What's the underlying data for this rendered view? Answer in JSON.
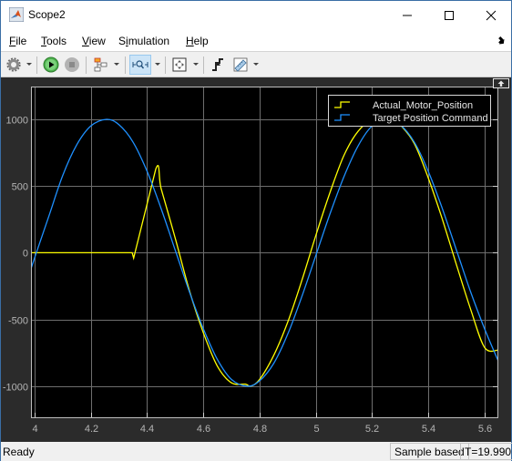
{
  "window": {
    "title": "Scope2",
    "controls": [
      "minimize",
      "maximize",
      "close"
    ]
  },
  "menubar": {
    "items": [
      {
        "label": "File",
        "mnemonic": "F"
      },
      {
        "label": "Tools",
        "mnemonic": "T"
      },
      {
        "label": "View",
        "mnemonic": "V"
      },
      {
        "label": "Simulation",
        "mnemonic": "i"
      },
      {
        "label": "Help",
        "mnemonic": "H"
      }
    ]
  },
  "toolbar": {
    "buttons": [
      {
        "name": "settings",
        "icon": "gear-icon",
        "dropdown": true
      },
      {
        "name": "run",
        "icon": "play-icon",
        "dropdown": false
      },
      {
        "name": "stop",
        "icon": "stop-icon",
        "dropdown": false,
        "disabled": true
      },
      {
        "name": "highlight-block",
        "icon": "block-diagram-icon",
        "dropdown": true
      },
      {
        "name": "zoom",
        "icon": "zoom-x-icon",
        "dropdown": true,
        "active": true
      },
      {
        "name": "scale-axes",
        "icon": "autoscale-icon",
        "dropdown": true
      },
      {
        "name": "triggers",
        "icon": "trigger-icon",
        "dropdown": false
      },
      {
        "name": "measurements",
        "icon": "ruler-icon",
        "dropdown": true
      }
    ]
  },
  "status": {
    "left": "Ready",
    "mode": "Sample based",
    "time": "T=19.990"
  },
  "colors": {
    "series_actual": "#ffff00",
    "series_target": "#1e90ff",
    "plot_bg": "#000000",
    "panel_bg": "#2b2b2b",
    "grid": "#6e6e6e",
    "tick_text": "#b4b4b4"
  },
  "chart_data": {
    "type": "line",
    "title": "",
    "xlabel": "",
    "ylabel": "",
    "xlim": [
      3.987,
      5.649
    ],
    "ylim": [
      -1240,
      1246
    ],
    "xticks": [
      4,
      4.2,
      4.4,
      4.6,
      4.8,
      5,
      5.2,
      5.4,
      5.6
    ],
    "xtick_labels": [
      "4",
      "4.2",
      "4.4",
      "4.6",
      "4.8",
      "5",
      "5.2",
      "5.4",
      "5.6"
    ],
    "yticks": [
      1000,
      500,
      0,
      -500,
      -1000
    ],
    "ytick_labels": [
      "1000",
      "500",
      "0",
      "-500",
      "-1000"
    ],
    "grid": true,
    "legend": {
      "position": "top-right",
      "entries": [
        "Actual_Motor_Position",
        "Target Position Command"
      ]
    },
    "series": [
      {
        "name": "Actual_Motor_Position",
        "color": "#ffff00",
        "x": [
          3.987,
          4.347,
          4.352,
          4.431,
          4.45,
          4.5,
          4.55,
          4.6,
          4.65,
          4.7,
          4.75,
          4.768,
          4.8,
          4.85,
          4.9,
          4.95,
          5.0,
          5.05,
          5.1,
          5.15,
          5.2,
          5.25,
          5.275,
          5.3,
          5.35,
          5.4,
          5.45,
          5.5,
          5.55,
          5.6,
          5.649
        ],
        "y": [
          0,
          0,
          -40,
          628,
          480,
          110,
          -280,
          -600,
          -850,
          -975,
          -985,
          -1000,
          -950,
          -770,
          -520,
          -210,
          130,
          450,
          730,
          910,
          995,
          990,
          1000,
          960,
          820,
          560,
          250,
          -90,
          -420,
          -710,
          -730
        ]
      },
      {
        "name": "Target Position Command",
        "color": "#1e90ff",
        "x": [
          3.987,
          4.006,
          4.05,
          4.1,
          4.15,
          4.2,
          4.256,
          4.3,
          4.35,
          4.4,
          4.45,
          4.5,
          4.55,
          4.6,
          4.65,
          4.7,
          4.756,
          4.8,
          4.85,
          4.9,
          4.95,
          5.0,
          5.05,
          5.1,
          5.15,
          5.2,
          5.256,
          5.3,
          5.35,
          5.4,
          5.45,
          5.5,
          5.55,
          5.6,
          5.649
        ],
        "y": [
          -120,
          0,
          270,
          580,
          810,
          950,
          1000,
          960,
          830,
          610,
          330,
          20,
          -290,
          -570,
          -800,
          -950,
          -1000,
          -960,
          -830,
          -610,
          -330,
          -20,
          290,
          570,
          800,
          950,
          1000,
          960,
          830,
          610,
          330,
          20,
          -290,
          -570,
          -813
        ]
      }
    ]
  }
}
